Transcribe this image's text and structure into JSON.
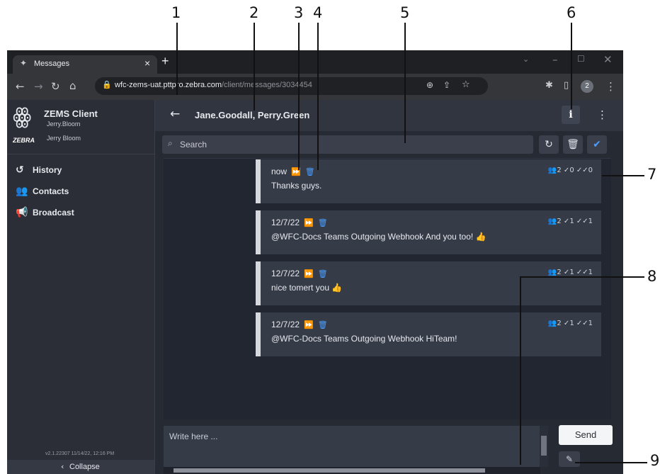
{
  "callouts": [
    "1",
    "2",
    "3",
    "4",
    "5",
    "6",
    "7",
    "8",
    "9"
  ],
  "browser": {
    "tab_title": "Messages",
    "tab_close": "×",
    "new_tab": "+",
    "url_host": "wfc-zems-uat.pttpro.zebra.com",
    "url_path": "/client/messages/3034454",
    "profile_badge": "2"
  },
  "sidebar": {
    "app_title": "ZEMS Client",
    "user_primary": "Jerry.Bloom",
    "brand": "ZEBRA",
    "user_secondary": "Jerry Bloom",
    "items": [
      {
        "label": "History",
        "icon": "history-icon"
      },
      {
        "label": "Contacts",
        "icon": "contacts-icon"
      },
      {
        "label": "Broadcast",
        "icon": "broadcast-icon"
      }
    ],
    "version": "v2.1.22307 11/14/22, 12:16 PM",
    "collapse_label": "Collapse"
  },
  "header": {
    "conversation_title": "Jane.Goodall, Perry.Green"
  },
  "search": {
    "placeholder": "Search"
  },
  "messages": [
    {
      "time": "now",
      "text": "Thanks guys.",
      "recipients": "2",
      "delivered": "0",
      "read": "0"
    },
    {
      "time": "12/7/22",
      "text": "@WFC-Docs Teams Outgoing Webhook And you too! 👍",
      "recipients": "2",
      "delivered": "1",
      "read": "1"
    },
    {
      "time": "12/7/22",
      "text": "nice tomert you 👍",
      "recipients": "2",
      "delivered": "1",
      "read": "1"
    },
    {
      "time": "12/7/22",
      "text": "@WFC-Docs Teams Outgoing Webhook HiTeam!",
      "recipients": "2",
      "delivered": "1",
      "read": "1"
    }
  ],
  "compose": {
    "placeholder": "Write here ...",
    "send_label": "Send"
  },
  "colors": {
    "accent": "#4a9eff",
    "panel": "#2b2e37",
    "message_bubble": "#363b48"
  }
}
